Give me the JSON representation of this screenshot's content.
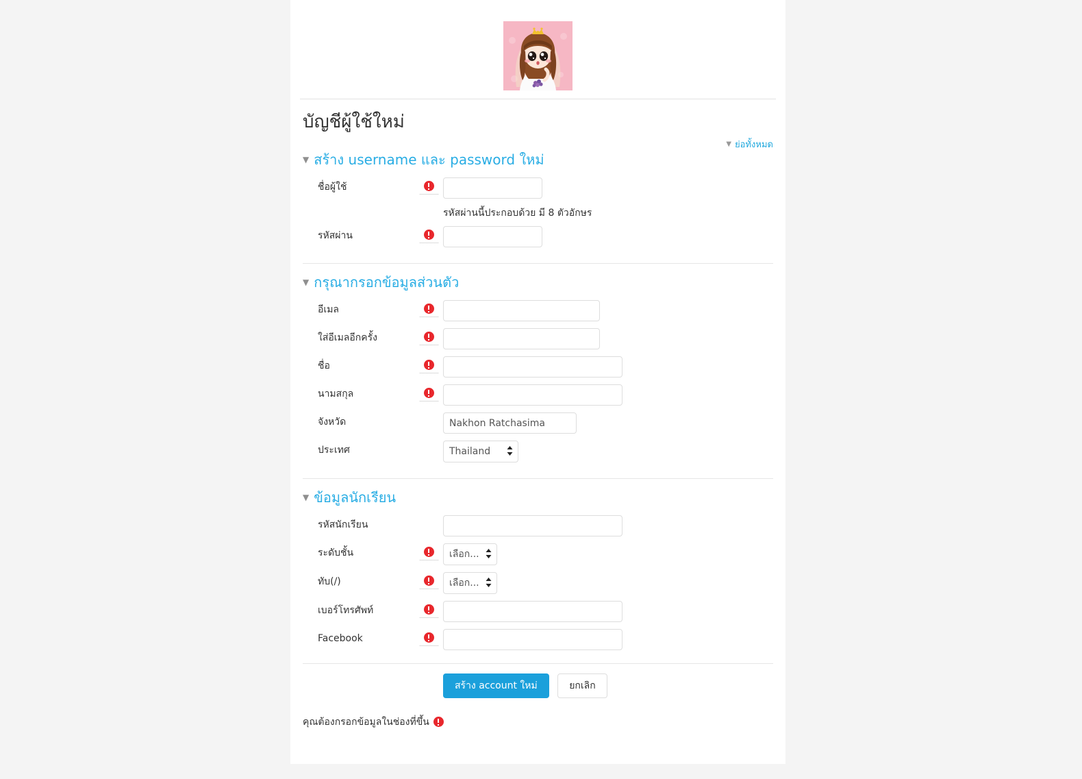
{
  "site": {
    "logo_alt": "site-logo-cartoon-princess",
    "logo_bg": "#f6b7c4"
  },
  "page": {
    "title": "บัญชีผู้ใช้ใหม่",
    "collapse_all": "ย่อทั้งหมด",
    "collapse_icon": "▼"
  },
  "colors": {
    "accent": "#29ade4",
    "link": "#1ea7dd",
    "primary_button": "#1ba0db",
    "required_marker": "#e8272c"
  },
  "sections": [
    {
      "id": "credentials",
      "legend": "สร้าง username และ password ใหม่",
      "toggle_icon": "▼",
      "fields": [
        {
          "label": "ชื่อผู้ใช้",
          "required": true,
          "type": "text",
          "value": "",
          "placeholder": ""
        },
        {
          "label": "รหัสผ่าน",
          "required": true,
          "type": "password",
          "value": "",
          "placeholder": "",
          "hint": "รหัสผ่านนี้ประกอบด้วย มี 8 ตัวอักษร"
        }
      ]
    },
    {
      "id": "personal",
      "legend": "กรุณากรอกข้อมูลส่วนตัว",
      "toggle_icon": "▼",
      "fields": [
        {
          "label": "อีเมล",
          "required": true,
          "type": "text",
          "value": "",
          "placeholder": ""
        },
        {
          "label": "ใส่อีเมลอีกครั้ง",
          "required": true,
          "type": "text",
          "value": "",
          "placeholder": ""
        },
        {
          "label": "ชื่อ",
          "required": true,
          "type": "text",
          "value": "",
          "placeholder": ""
        },
        {
          "label": "นามสกุล",
          "required": true,
          "type": "text",
          "value": "",
          "placeholder": ""
        },
        {
          "label": "จังหวัด",
          "required": false,
          "type": "text",
          "value": "Nakhon Ratchasima",
          "placeholder": ""
        },
        {
          "label": "ประเทศ",
          "required": false,
          "type": "select",
          "value": "Thailand",
          "options": [
            "Thailand"
          ]
        }
      ]
    },
    {
      "id": "student",
      "legend": "ข้อมูลนักเรียน",
      "toggle_icon": "▼",
      "fields": [
        {
          "label": "รหัสนักเรียน",
          "required": false,
          "type": "text",
          "value": "",
          "placeholder": ""
        },
        {
          "label": "ระดับชั้น",
          "required": true,
          "type": "select",
          "value": "เลือก...",
          "options": [
            "เลือก..."
          ]
        },
        {
          "label": "ทับ(/)",
          "required": true,
          "type": "select",
          "value": "เลือก...",
          "options": [
            "เลือก..."
          ]
        },
        {
          "label": "เบอร์โทรศัพท์",
          "required": true,
          "type": "text",
          "value": "",
          "placeholder": ""
        },
        {
          "label": "Facebook",
          "required": true,
          "type": "text",
          "value": "",
          "placeholder": ""
        }
      ]
    }
  ],
  "actions": {
    "submit_label": "สร้าง account ใหม่",
    "cancel_label": "ยกเลิก"
  },
  "footer": {
    "required_note": "คุณต้องกรอกข้อมูลในช่องที่ขึ้น"
  },
  "labels": {
    "username": "ชื่อผู้ใช้",
    "password": "รหัสผ่าน",
    "password_hint": "รหัสผ่านนี้ประกอบด้วย มี 8 ตัวอักษร",
    "email": "อีเมล",
    "email_again": "ใส่อีเมลอีกครั้ง",
    "firstname": "ชื่อ",
    "lastname": "นามสกุล",
    "city": "จังหวัด",
    "country": "ประเทศ",
    "student_id": "รหัสนักเรียน",
    "grade": "ระดับชั้น",
    "room": "ทับ(/)",
    "phone": "เบอร์โทรศัพท์",
    "facebook": "Facebook"
  },
  "values": {
    "city": "Nakhon Ratchasima",
    "country": "Thailand",
    "grade": "เลือก...",
    "room": "เลือก...",
    "select_arrows": "⬍"
  }
}
